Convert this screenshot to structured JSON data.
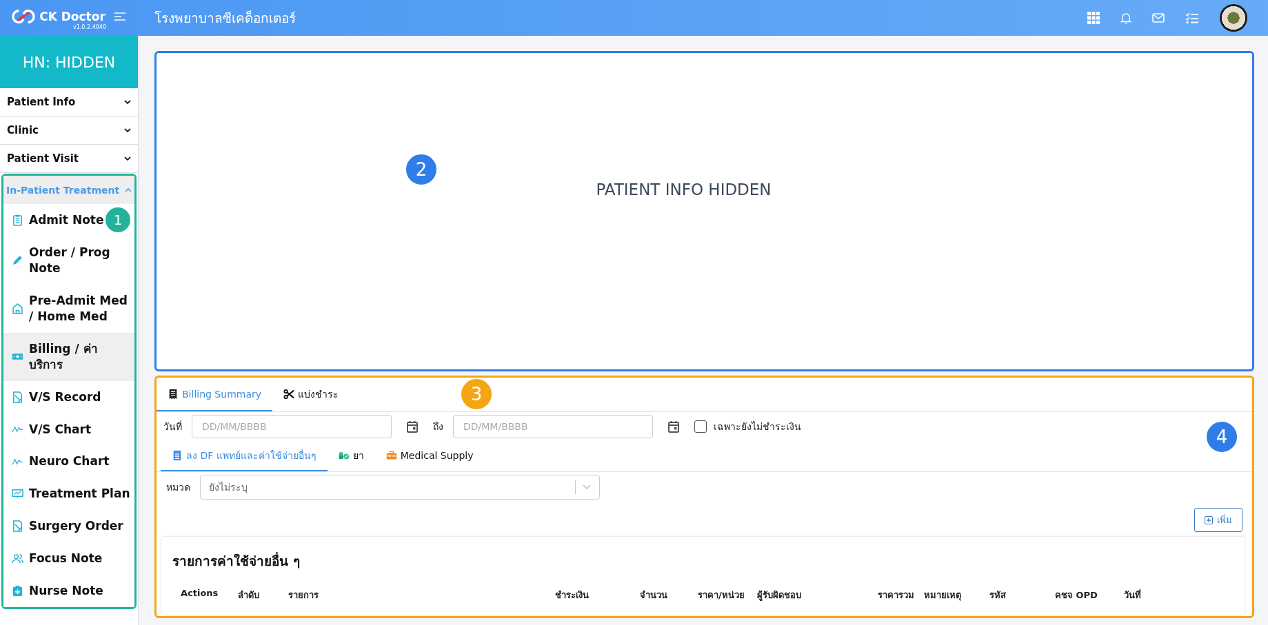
{
  "header": {
    "brand": "CK Doctor",
    "version": "v1.0.2.4040",
    "hospital": "โรงพยาบาลซีเคด็อกเตอร์"
  },
  "patient": {
    "hn": "HN: HIDDEN",
    "info": "PATIENT INFO HIDDEN"
  },
  "sidebar": {
    "sections": [
      {
        "label": "Patient Info",
        "expanded": false
      },
      {
        "label": "Clinic",
        "expanded": false
      },
      {
        "label": "Patient Visit",
        "expanded": false
      },
      {
        "label": "In-Patient Treatment",
        "expanded": true,
        "children": [
          {
            "label": "Admit Note",
            "kind": "clipboard",
            "selected": false
          },
          {
            "label": "Order / Prog Note",
            "kind": "pencil",
            "selected": false
          },
          {
            "label": "Pre-Admit Med / Home Med",
            "kind": "home",
            "selected": false
          },
          {
            "label": "Billing / ค่าบริการ",
            "kind": "money",
            "selected": true
          },
          {
            "label": "V/S Record",
            "kind": "sheet",
            "selected": false
          },
          {
            "label": "V/S Chart",
            "kind": "pulse",
            "selected": false
          },
          {
            "label": "Neuro Chart",
            "kind": "pulse",
            "selected": false
          },
          {
            "label": "Treatment Plan",
            "kind": "board",
            "selected": false
          },
          {
            "label": "Surgery Order",
            "kind": "sheet",
            "selected": false
          },
          {
            "label": "Focus Note",
            "kind": "people",
            "selected": false
          },
          {
            "label": "Nurse Note",
            "kind": "medkit",
            "selected": false
          }
        ]
      }
    ]
  },
  "billing": {
    "tabs": [
      {
        "label": "Billing Summary",
        "selected": true
      },
      {
        "label": "แบ่งชำระ",
        "selected": false
      }
    ],
    "date_label": "วันที่",
    "date_from": {
      "placeholder": "DD/MM/BBBB"
    },
    "to_label": "ถึง",
    "date_to": {
      "placeholder": "DD/MM/BBBB"
    },
    "unpaid_only": {
      "label": "เฉพาะยังไม่ชำระเงิน",
      "checked": false
    },
    "subtabs": [
      {
        "label": "ลง DF แพทย์และค่าใช้จ่ายอื่นๆ",
        "selected": true
      },
      {
        "label": "ยา",
        "selected": false
      },
      {
        "label": "Medical Supply",
        "selected": false
      }
    ],
    "category": {
      "label": "หมวด",
      "placeholder": "ยังไม่ระบุ"
    },
    "add_button": "เพิ่ม",
    "list_title": "รายการค่าใช้จ่ายอื่น ๆ",
    "columns": [
      "Actions",
      "ลำดับ",
      "รายการ",
      "ชำระเงิน",
      "จำนวน",
      "ราคา/หน่วย",
      "ผู้รับผิดชอบ",
      "ราคารวม",
      "หมายเหตุ",
      "รหัส",
      "คชจ OPD",
      "วันที่"
    ]
  },
  "annotations": [
    {
      "number": "1",
      "color": "#22b39a"
    },
    {
      "number": "2",
      "color": "#2f7de8"
    },
    {
      "number": "3",
      "color": "#f5a512"
    },
    {
      "number": "4",
      "color": "#2f7de8"
    }
  ]
}
